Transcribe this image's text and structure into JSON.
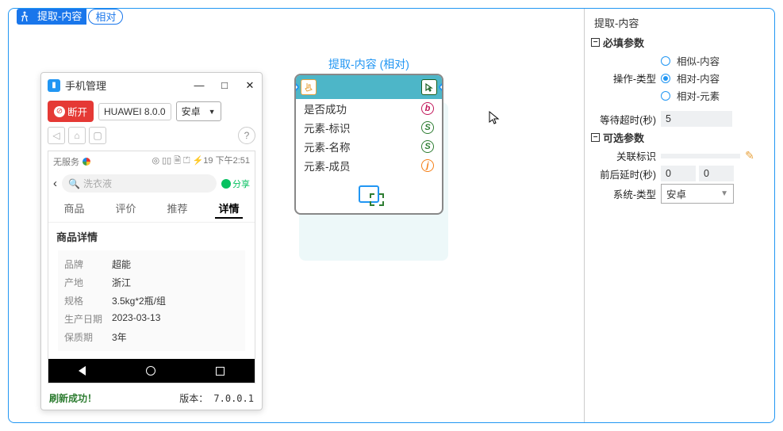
{
  "chip": {
    "t1": "提取-内容",
    "t2": "相对"
  },
  "right": {
    "title": "提取-内容",
    "sec1": "必填参数",
    "op_label": "操作-类型",
    "op_options": [
      "相似-内容",
      "相对-内容",
      "相对-元素"
    ],
    "op_selected": 1,
    "wait_label": "等待超时(秒)",
    "wait_val": "5",
    "sec2": "可选参数",
    "rel_label": "关联标识",
    "rel_val": "",
    "delay_label": "前后延时(秒)",
    "delay_before": "0",
    "delay_after": "0",
    "sys_label": "系统-类型",
    "sys_val": "安卓"
  },
  "node": {
    "title": "提取-内容 (相对)",
    "rows": [
      {
        "label": "是否成功",
        "badge": "b",
        "cls": "b"
      },
      {
        "label": "元素-标识",
        "badge": "S",
        "cls": "s"
      },
      {
        "label": "元素-名称",
        "badge": "S",
        "cls": "s"
      },
      {
        "label": "元素-成员",
        "badge": "j",
        "cls": "j"
      }
    ]
  },
  "phone": {
    "title": "手机管理",
    "disconnect": "断开",
    "device": "HUAWEI 8.0.0",
    "os": "安卓",
    "status_left": "无服务",
    "status_right": "下午2:51",
    "search_placeholder": "洗衣液",
    "share": "分享",
    "tabs": [
      "商品",
      "评价",
      "推荐",
      "详情"
    ],
    "active_tab": 3,
    "section": "商品详情",
    "details": [
      {
        "k": "品牌",
        "v": "超能"
      },
      {
        "k": "产地",
        "v": "浙江"
      },
      {
        "k": "规格",
        "v": "3.5kg*2瓶/组"
      },
      {
        "k": "生产日期",
        "v": "2023-03-13"
      },
      {
        "k": "保质期",
        "v": "3年"
      }
    ],
    "footer_ok": "刷新成功！",
    "footer_ver": "版本： 7.0.0.1"
  }
}
